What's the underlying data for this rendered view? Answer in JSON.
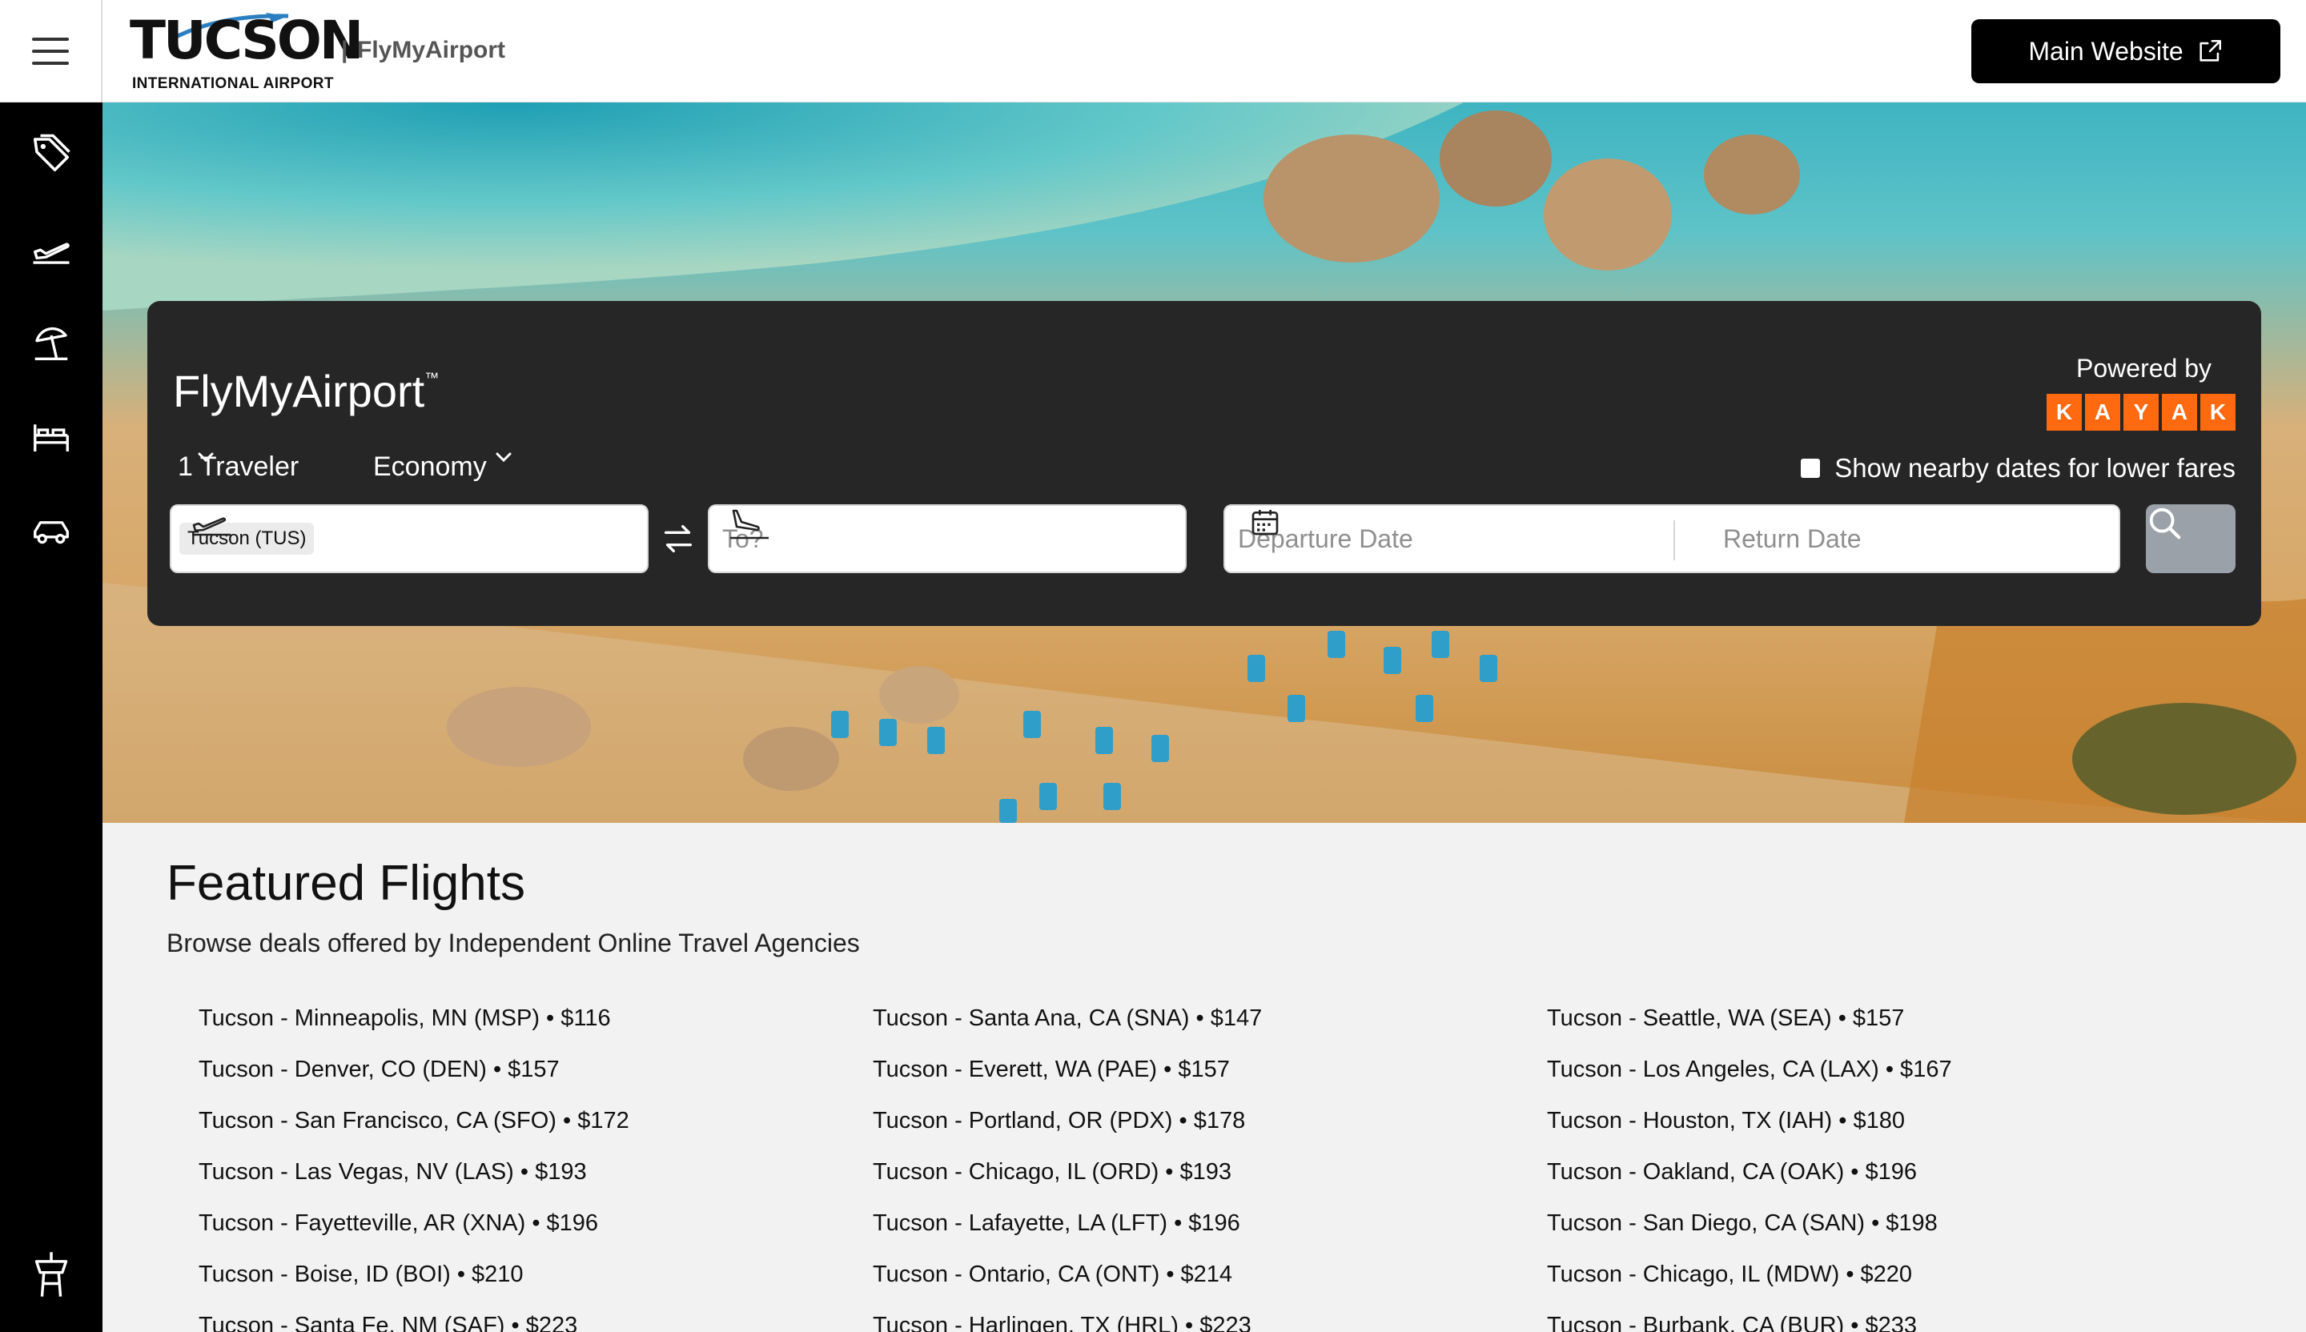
{
  "header": {
    "logo_word": "TUCSON",
    "logo_sub": "INTERNATIONAL AIRPORT",
    "logo_tm": "™",
    "brand_sep": "|",
    "brand_name": "FlyMyAirport",
    "main_site_label": "Main Website"
  },
  "sidebar": {
    "items": [
      {
        "icon": "tag-icon"
      },
      {
        "icon": "plane-takeoff-icon"
      },
      {
        "icon": "beach-umbrella-icon"
      },
      {
        "icon": "bed-icon"
      },
      {
        "icon": "car-icon"
      }
    ],
    "bottom_icon": "control-tower-icon"
  },
  "search": {
    "title": "FlyMyAirport",
    "title_tm": "™",
    "powered_by": "Powered by",
    "kayak_letters": [
      "K",
      "A",
      "Y",
      "A",
      "K"
    ],
    "travelers": "1 Traveler",
    "cabin": "Economy",
    "nearby_label": "Show nearby dates for lower fares",
    "nearby_checked": false,
    "from_value": "Tucson (TUS)",
    "to_placeholder": "To?",
    "departure_placeholder": "Departure Date",
    "return_placeholder": "Return Date"
  },
  "featured": {
    "title": "Featured Flights",
    "subtitle": "Browse deals offered by Independent Online Travel Agencies",
    "columns": [
      [
        "Tucson - Minneapolis, MN (MSP) • $116",
        "Tucson - Denver, CO (DEN) • $157",
        "Tucson - San Francisco, CA (SFO) • $172",
        "Tucson - Las Vegas, NV (LAS) • $193",
        "Tucson - Fayetteville, AR (XNA) • $196",
        "Tucson - Boise, ID (BOI) • $210",
        "Tucson - Santa Fe, NM (SAF) • $223"
      ],
      [
        "Tucson - Santa Ana, CA (SNA) • $147",
        "Tucson - Everett, WA (PAE) • $157",
        "Tucson - Portland, OR (PDX) • $178",
        "Tucson - Chicago, IL (ORD) • $193",
        "Tucson - Lafayette, LA (LFT) • $196",
        "Tucson - Ontario, CA (ONT) • $214",
        "Tucson - Harlingen, TX (HRL) • $223"
      ],
      [
        "Tucson - Seattle, WA (SEA) • $157",
        "Tucson - Los Angeles, CA (LAX) • $167",
        "Tucson - Houston, TX (IAH) • $180",
        "Tucson - Oakland, CA (OAK) • $196",
        "Tucson - San Diego, CA (SAN) • $198",
        "Tucson - Chicago, IL (MDW) • $220",
        "Tucson - Burbank, CA (BUR) • $233"
      ]
    ]
  }
}
